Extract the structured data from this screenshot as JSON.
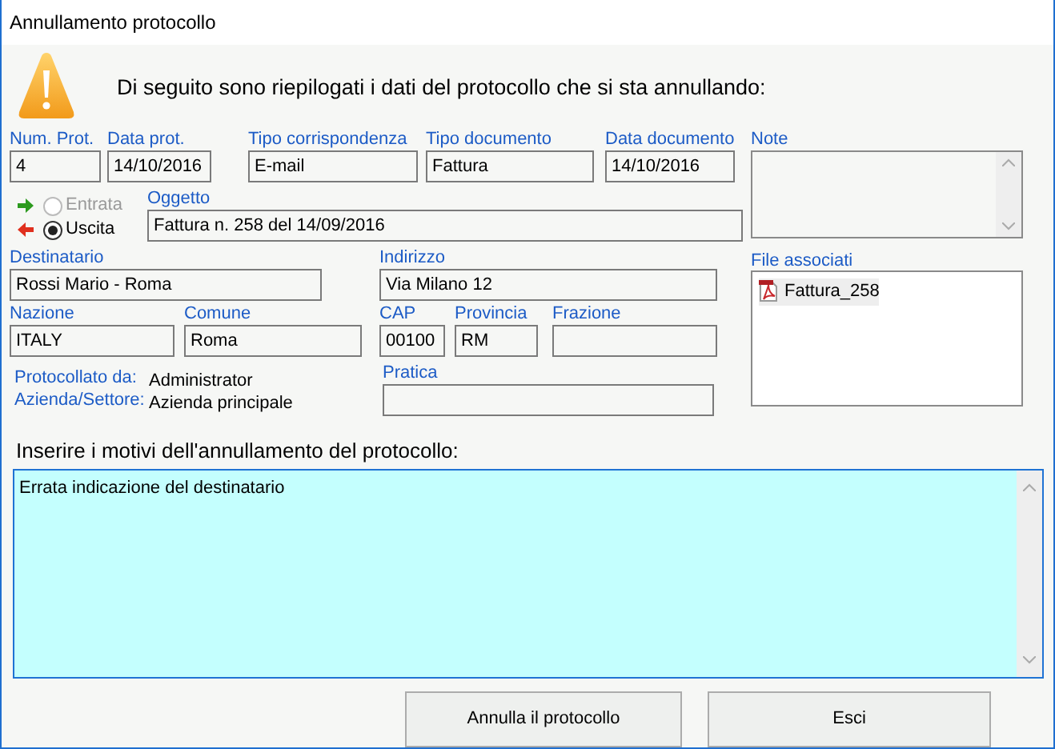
{
  "window": {
    "title": "Annullamento protocollo"
  },
  "message": "Di seguito sono riepilogati i dati del protocollo che si sta annullando:",
  "header_fields": [
    {
      "label": "Num. Prot.",
      "value": "4"
    },
    {
      "label": "Data prot.",
      "value": "14/10/2016"
    },
    {
      "label": "Tipo corrispondenza",
      "value": "E-mail"
    },
    {
      "label": "Tipo documento",
      "value": "Fattura"
    },
    {
      "label": "Data documento",
      "value": "14/10/2016"
    }
  ],
  "direction_options": [
    {
      "label": "Entrata",
      "selected": false,
      "disabled": true,
      "kind": "incoming"
    },
    {
      "label": "Uscita",
      "selected": true,
      "disabled": false,
      "kind": "outgoing"
    }
  ],
  "subject_field": {
    "label": "Oggetto",
    "value": "Fattura n. 258 del 14/09/2016"
  },
  "recipient_fields": [
    {
      "label": "Destinatario",
      "value": "Rossi Mario - Roma"
    },
    {
      "label": "Indirizzo",
      "value": "Via Milano 12"
    },
    {
      "label": "Nazione",
      "value": "ITALY"
    },
    {
      "label": "Comune",
      "value": "Roma"
    },
    {
      "label": "CAP",
      "value": "00100"
    },
    {
      "label": "Provincia",
      "value": "RM"
    },
    {
      "label": "Frazione"
    }
  ],
  "registration_info": [
    {
      "label": "Protocollato da:",
      "value": "Administrator"
    },
    {
      "label": "Azienda/Settore:",
      "value": "Azienda principale"
    }
  ],
  "practice_field": {
    "label": "Pratica"
  },
  "note_field": {
    "label": "Note"
  },
  "attachments": {
    "label": "File associati",
    "files": [
      {
        "name": "Fattura_258"
      }
    ]
  },
  "reason": {
    "label": "Inserire i motivi dell'annullamento del protocollo:",
    "value": "Errata indicazione del destinatario"
  },
  "buttons": [
    {
      "label": "Annulla il protocollo"
    },
    {
      "label": "Esci"
    }
  ]
}
